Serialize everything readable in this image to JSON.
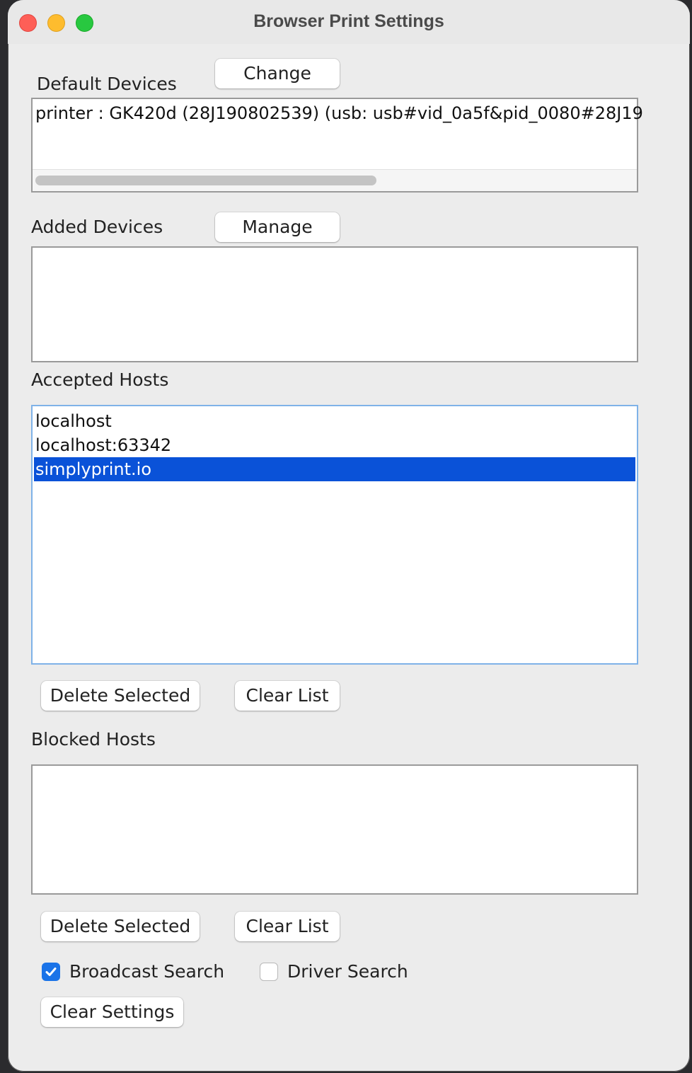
{
  "window": {
    "title": "Browser Print Settings"
  },
  "default_devices": {
    "label": "Default Devices",
    "change_label": "Change",
    "items": [
      "printer : GK420d (28J190802539) (usb: usb#vid_0a5f&pid_0080#28J19"
    ]
  },
  "added_devices": {
    "label": "Added Devices",
    "manage_label": "Manage",
    "items": []
  },
  "accepted_hosts": {
    "label": "Accepted Hosts",
    "items": [
      "localhost",
      "localhost:63342",
      "simplyprint.io"
    ],
    "selected_index": 2,
    "delete_label": "Delete Selected",
    "clear_label": "Clear List"
  },
  "blocked_hosts": {
    "label": "Blocked Hosts",
    "items": [],
    "delete_label": "Delete Selected",
    "clear_label": "Clear List"
  },
  "options": {
    "broadcast_search_label": "Broadcast Search",
    "broadcast_search_checked": true,
    "driver_search_label": "Driver Search",
    "driver_search_checked": false,
    "clear_settings_label": "Clear Settings"
  },
  "colors": {
    "selection": "#0a52d8",
    "checkbox_accent": "#1a73e8",
    "close": "#fe5f57",
    "minimize": "#febc2e",
    "maximize": "#28c840"
  }
}
